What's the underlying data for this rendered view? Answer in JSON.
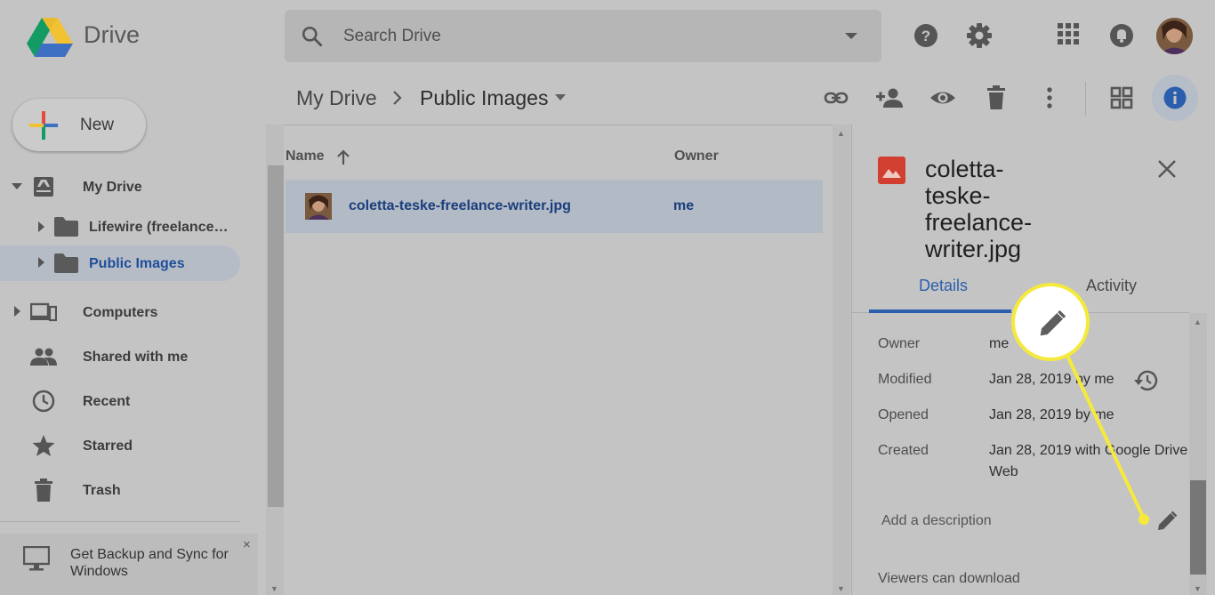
{
  "app": {
    "name": "Drive"
  },
  "search": {
    "placeholder": "Search Drive"
  },
  "breadcrumb": {
    "root": "My Drive",
    "current": "Public Images"
  },
  "sidebar": {
    "new_label": "New",
    "items": [
      {
        "label": "My Drive",
        "icon": "drive-icon"
      },
      {
        "label": "Lifewire (freelance…",
        "icon": "folder-icon"
      },
      {
        "label": "Public Images",
        "icon": "folder-icon",
        "selected": true
      },
      {
        "label": "Computers",
        "icon": "computers-icon"
      },
      {
        "label": "Shared with me",
        "icon": "people-icon"
      },
      {
        "label": "Recent",
        "icon": "clock-icon"
      },
      {
        "label": "Starred",
        "icon": "star-icon"
      },
      {
        "label": "Trash",
        "icon": "trash-icon"
      }
    ],
    "backup_promo": "Get Backup and Sync for Windows",
    "backup_close": "×"
  },
  "file_list": {
    "columns": {
      "name": "Name",
      "owner": "Owner"
    },
    "rows": [
      {
        "name": "coletta-teske-freelance-writer.jpg",
        "owner": "me"
      }
    ]
  },
  "details": {
    "title": "coletta-teske-freelance-writer.jpg",
    "tabs": [
      "Details",
      "Activity"
    ],
    "active_tab": "Details",
    "fields": [
      {
        "key": "Owner",
        "value": "me"
      },
      {
        "key": "Modified",
        "value": "Jan 28, 2019 by me"
      },
      {
        "key": "Opened",
        "value": "Jan 28, 2019 by me"
      },
      {
        "key": "Created",
        "value": "Jan 28, 2019 with Google Drive Web"
      }
    ],
    "add_description": "Add a description",
    "viewers_download": "Viewers can download"
  },
  "colors": {
    "accent_blue": "#2b5fae",
    "callout_yellow": "#f5ea3c",
    "overlay_gray": "#c4c4c4"
  }
}
